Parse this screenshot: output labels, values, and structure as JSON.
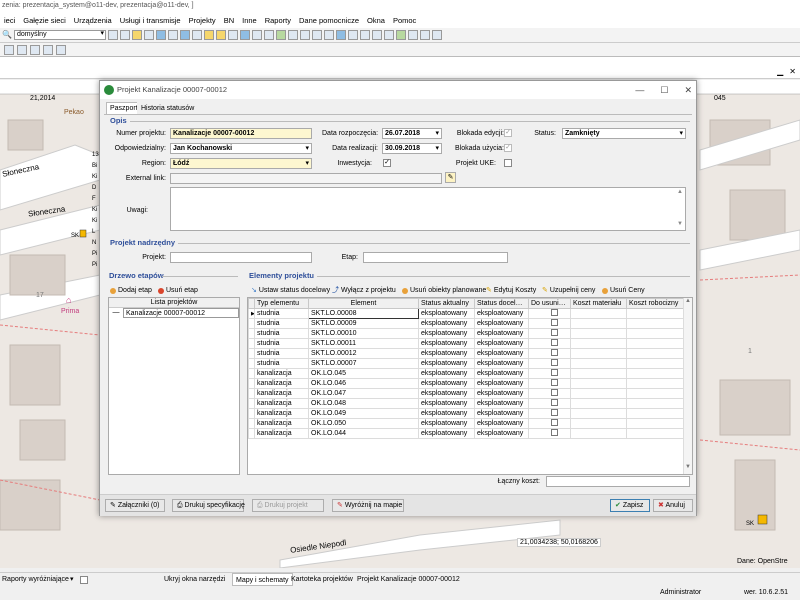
{
  "app": {
    "title": "zenia: prezentacja_system@o11-dev, prezentacja@o11-dev, ]"
  },
  "menu": [
    "ieci",
    "Gałęzie sieci",
    "Urządzenia",
    "Usługi i transmisje",
    "Projekty",
    "BN",
    "Inne",
    "Raporty",
    "Dane pomocnicze",
    "Okna",
    "Pomoc"
  ],
  "toolbar": {
    "domain_value": "domyślny"
  },
  "map": {
    "ruler_left": "21,2014",
    "ruler_right": "045",
    "street_top": "Słoneczna",
    "street_mid": "Słoneczna",
    "street_bottom": "Osiedle Niepodl",
    "poi_pekao": "Pekao",
    "poi_prima": "Prima",
    "label_sk_left": "SK",
    "label_sk_right": "SK",
    "num_17": "17",
    "num_1": "1",
    "coords": "21,0034238; 50,0168206",
    "credit": "Dane: OpenStre",
    "left_letters": [
      "13",
      "Bi",
      "Ki",
      "D",
      "F",
      "Ki",
      "Ki",
      "L",
      "N",
      "Pi",
      "Pi"
    ]
  },
  "dialog": {
    "title": "Projekt Kanalizacje 00007-00012",
    "tabs": [
      "Paszport",
      "Historia statusów"
    ],
    "opis_header": "Opis",
    "fields": {
      "numer_label": "Numer projektu:",
      "numer_value": "Kanalizacje 00007-00012",
      "odp_label": "Odpowiedzialny:",
      "odp_value": "Jan Kochanowski",
      "region_label": "Region:",
      "region_value": "Łódź",
      "ext_label": "External link:",
      "ext_value": "",
      "uwagi_label": "Uwagi:",
      "uwagi_value": "",
      "data_rozp_label": "Data rozpoczęcia:",
      "data_rozp_value": "26.07.2018",
      "data_real_label": "Data realizacji:",
      "data_real_value": "30.09.2018",
      "inwestycja_label": "Inwestycja:",
      "blokada_edycji_label": "Blokada edycji:",
      "blokada_uzycia_label": "Blokada użycia:",
      "projekt_uke_label": "Projekt UKE:",
      "status_label": "Status:",
      "status_value": "Zamknięty"
    },
    "nadrzedny_header": "Projekt nadrzędny",
    "nadrzedny": {
      "projekt_label": "Projekt:",
      "etap_label": "Etap:"
    },
    "drzewo": {
      "header": "Drzewo etapów",
      "add": "Dodaj etap",
      "remove": "Usuń etap",
      "col": "Lista projektów",
      "items": [
        {
          "mark": "—",
          "label": "Kanalizacje 00007-00012"
        }
      ]
    },
    "elementy": {
      "header": "Elementy projektu",
      "buttons": [
        "Ustaw status docelowy",
        "Wyłącz z projektu",
        "Usuń obiekty planowane",
        "Edytuj Koszty",
        "Uzupełnij ceny",
        "Usuń Ceny"
      ],
      "columns": [
        "Typ elementu",
        "Element",
        "Status aktualny",
        "Status docel…",
        "Do usuni…",
        "Koszt materiału",
        "Koszt robocizny"
      ],
      "rows": [
        [
          "studnia",
          "SKT.LO.00008",
          "eksploatowany",
          "eksploatowany"
        ],
        [
          "studnia",
          "SKT.LO.00009",
          "eksploatowany",
          "eksploatowany"
        ],
        [
          "studnia",
          "SKT.LO.00010",
          "eksploatowany",
          "eksploatowany"
        ],
        [
          "studnia",
          "SKT.LO.00011",
          "eksploatowany",
          "eksploatowany"
        ],
        [
          "studnia",
          "SKT.LO.00012",
          "eksploatowany",
          "eksploatowany"
        ],
        [
          "studnia",
          "SKT.LO.00007",
          "eksploatowany",
          "eksploatowany"
        ],
        [
          "kanalizacja",
          "OK.LO.045",
          "eksploatowany",
          "eksploatowany"
        ],
        [
          "kanalizacja",
          "OK.LO.046",
          "eksploatowany",
          "eksploatowany"
        ],
        [
          "kanalizacja",
          "OK.LO.047",
          "eksploatowany",
          "eksploatowany"
        ],
        [
          "kanalizacja",
          "OK.LO.048",
          "eksploatowany",
          "eksploatowany"
        ],
        [
          "kanalizacja",
          "OK.LO.049",
          "eksploatowany",
          "eksploatowany"
        ],
        [
          "kanalizacja",
          "OK.LO.050",
          "eksploatowany",
          "eksploatowany"
        ],
        [
          "kanalizacja",
          "OK.LO.044",
          "eksploatowany",
          "eksploatowany"
        ]
      ],
      "total_label": "Łączny koszt:"
    },
    "footer": {
      "zalaczniki": "Załączniki (0)",
      "drukuj_spec": "Drukuj specyfikację",
      "drukuj_proj": "Drukuj projekt",
      "wyroznij": "Wyróżnij na mapie",
      "zapisz": "Zapisz",
      "anuluj": "Anuluj"
    }
  },
  "statusbar": {
    "raporty": "Raporty wyróżniające",
    "ukryj": "Ukryj okna narzędzi",
    "mapy": "Mapy i schematy",
    "kartoteka": "Kartoteka projektów",
    "projekt": "Projekt Kanalizacje 00007-00012",
    "user": "Administrator",
    "version": "wer. 10.6.2.51"
  },
  "colors": {
    "accent": "#2f4f9a",
    "highlight_field": "#fdf7d0",
    "map_bg": "#ede8e3"
  }
}
